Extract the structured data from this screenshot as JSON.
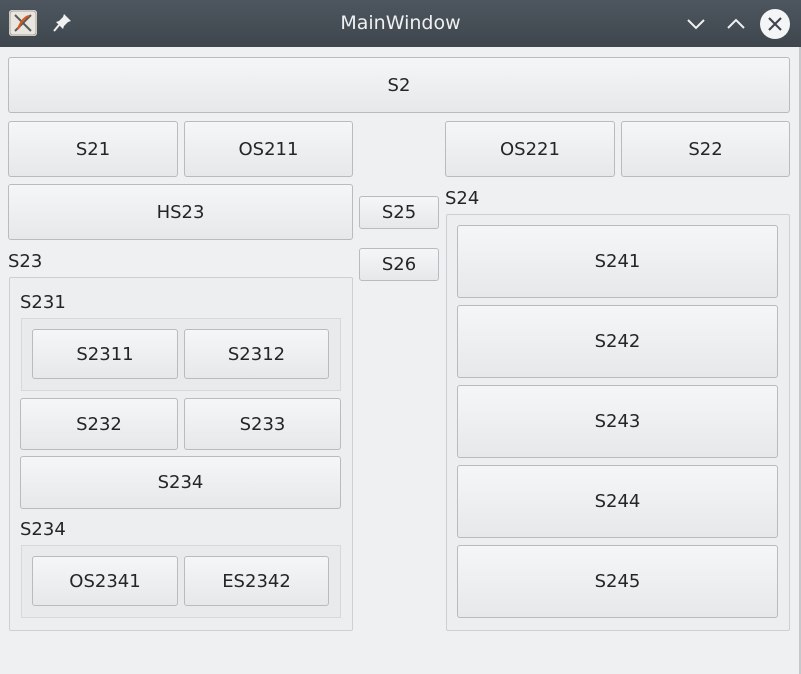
{
  "window": {
    "title": "MainWindow"
  },
  "icons": {
    "app": "app-logo-icon",
    "pin": "pin-icon",
    "minimize": "chevron-down-icon",
    "maximize": "chevron-up-icon",
    "close": "close-icon"
  },
  "buttons": {
    "s2": "S2",
    "s21": "S21",
    "os211": "OS211",
    "os221": "OS221",
    "s22": "S22",
    "hs23": "HS23",
    "s25": "S25",
    "s26": "S26",
    "s2311": "S2311",
    "s2312": "S2312",
    "s232": "S232",
    "s233": "S233",
    "s234": "S234",
    "os2341": "OS2341",
    "es2342": "ES2342",
    "s241": "S241",
    "s242": "S242",
    "s243": "S243",
    "s244": "S244",
    "s245": "S245"
  },
  "groups": {
    "s23": "S23",
    "s231": "S231",
    "s234": "S234",
    "s24": "S24"
  }
}
